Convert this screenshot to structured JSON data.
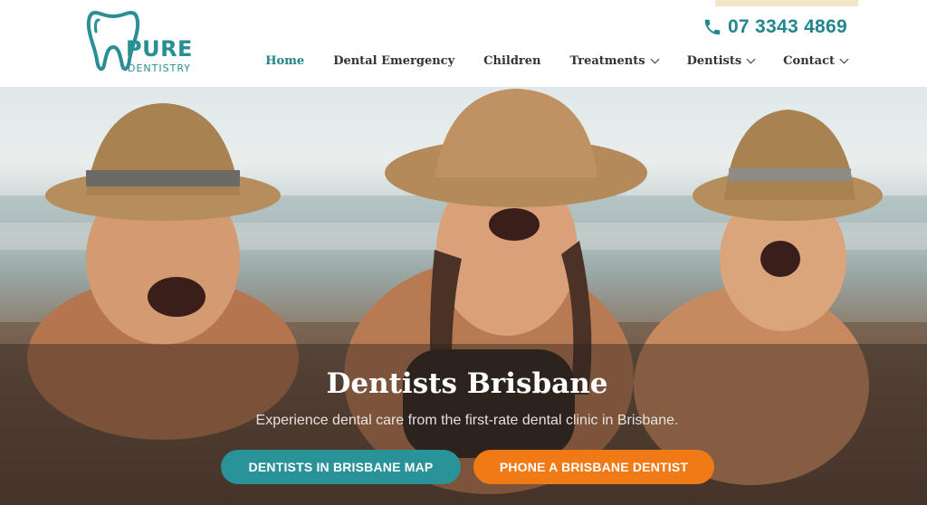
{
  "brand": {
    "logo_word": "PURE",
    "logo_sub": "DENTISTRY",
    "color": "#2a8e95"
  },
  "header": {
    "phone": "07 3343 4869",
    "phone_icon": "phone-icon"
  },
  "nav": {
    "items": [
      {
        "label": "Home",
        "active": true
      },
      {
        "label": "Dental Emergency",
        "active": false
      },
      {
        "label": "Children",
        "active": false
      },
      {
        "label": "Treatments",
        "active": false,
        "dropdown": true
      },
      {
        "label": "Dentists",
        "active": false,
        "dropdown": true
      },
      {
        "label": "Contact",
        "active": false,
        "dropdown": true
      }
    ]
  },
  "hero": {
    "title": "Dentists Brisbane",
    "subtitle": "Experience dental care from the first-rate dental clinic in Brisbane.",
    "buttons": [
      {
        "label": "DENTISTS IN BRISBANE MAP",
        "color": "#2a939a"
      },
      {
        "label": "PHONE A BRISBANE DENTIST",
        "color": "#f07a16"
      }
    ]
  }
}
